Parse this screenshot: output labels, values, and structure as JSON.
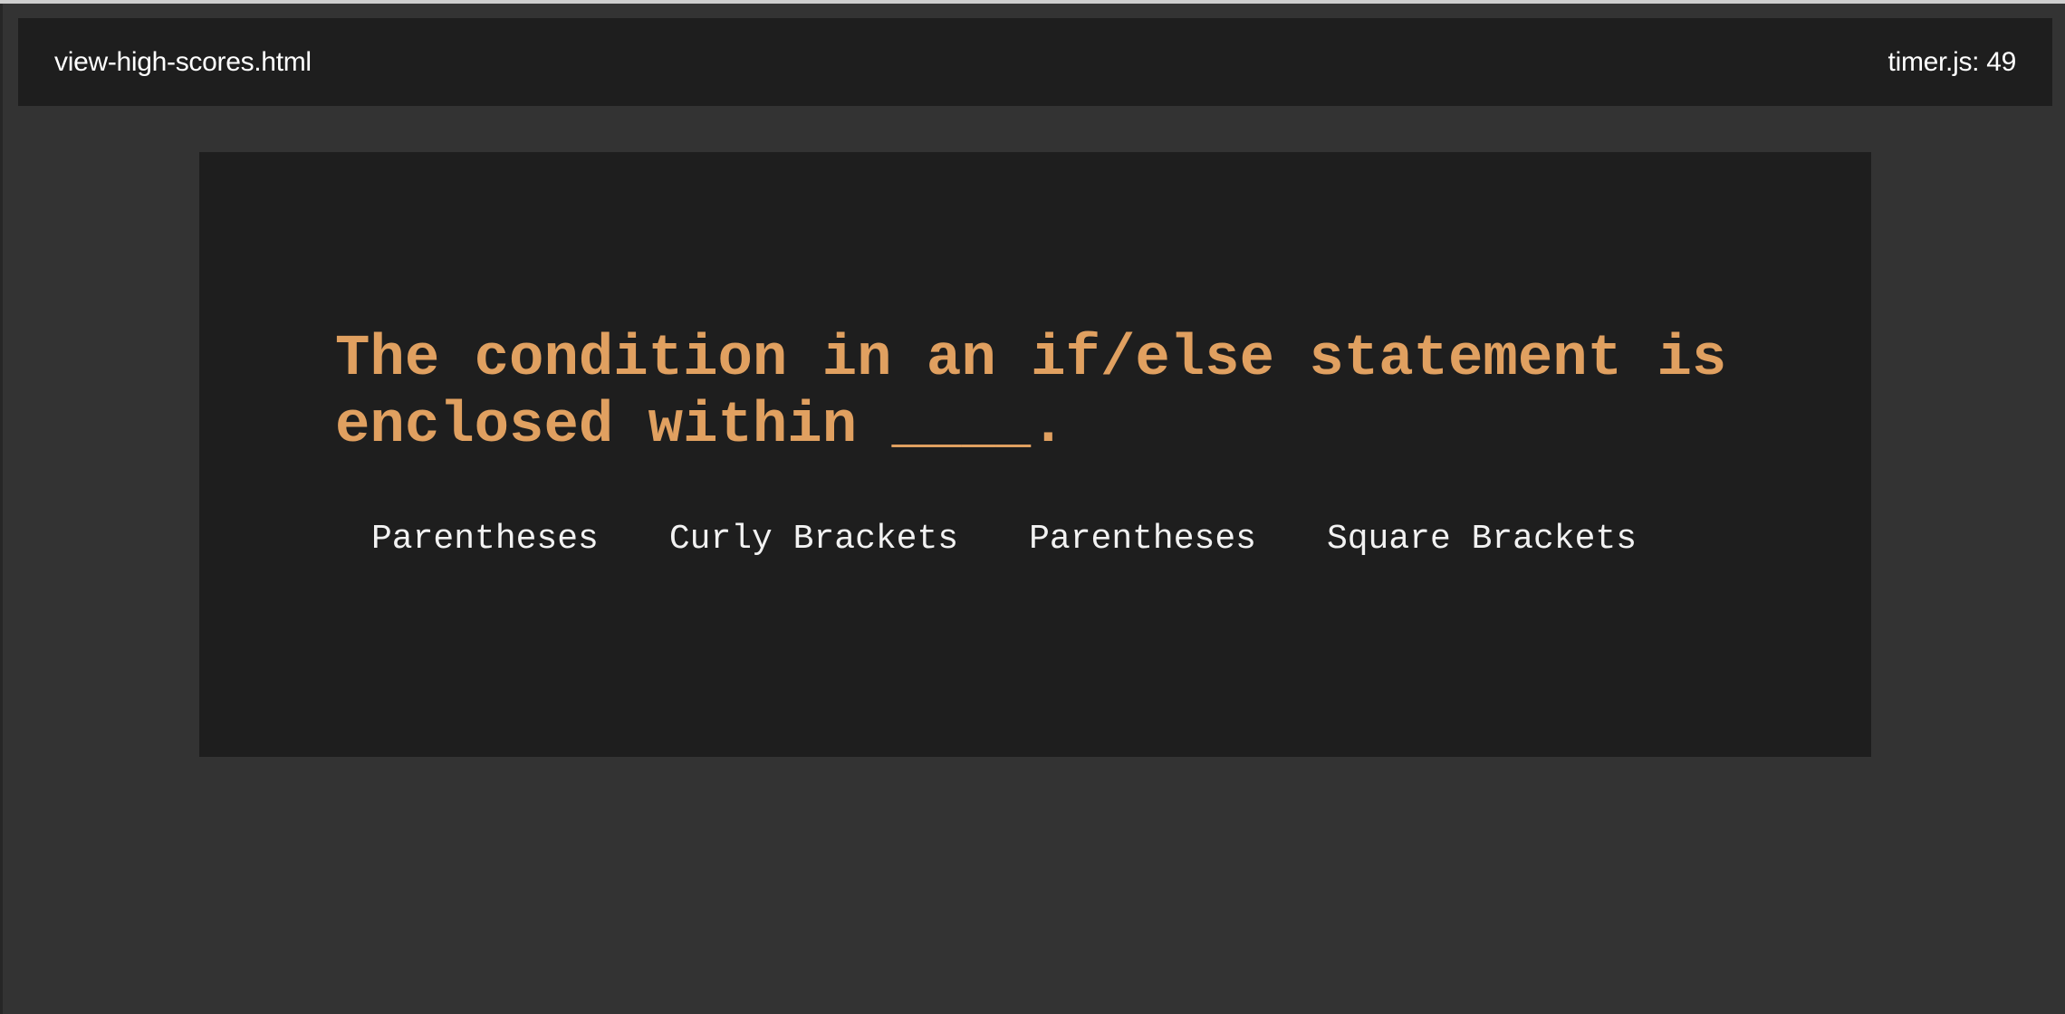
{
  "header": {
    "high_scores_link": "view-high-scores.html",
    "timer_label": "timer.js: 49"
  },
  "quiz": {
    "question": "The condition in an if/else statement is enclosed within ____.",
    "choices": [
      "Parentheses",
      "Curly Brackets",
      "Parentheses",
      "Square Brackets"
    ]
  },
  "colors": {
    "page_background": "#333333",
    "panel_background": "#1e1e1e",
    "question_text": "#e0a060",
    "choice_text": "#f2f2f2"
  }
}
